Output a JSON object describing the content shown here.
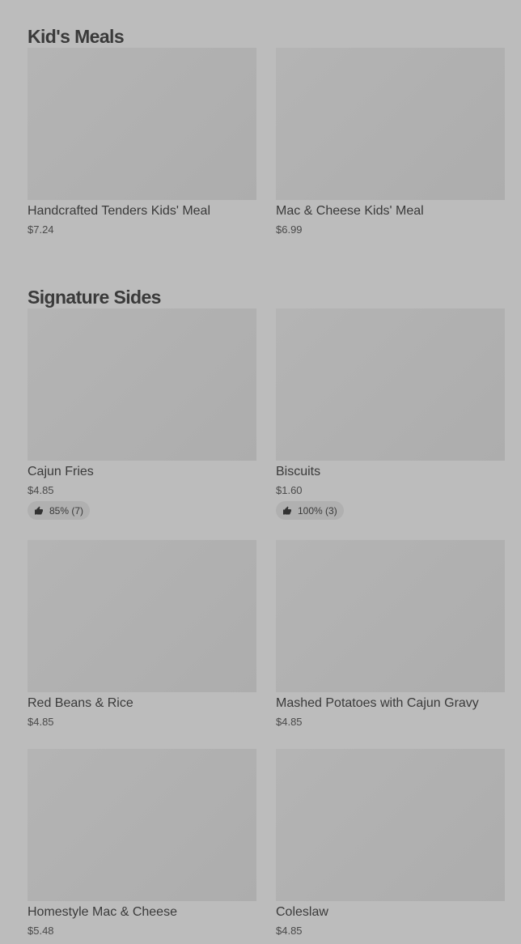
{
  "sections": [
    {
      "title": "Kid's Meals",
      "items": [
        {
          "name": "Handcrafted Tenders Kids' Meal",
          "price": "$7.24"
        },
        {
          "name": "Mac & Cheese Kids' Meal",
          "price": "$6.99"
        }
      ]
    },
    {
      "title": "Signature Sides",
      "items": [
        {
          "name": "Cajun Fries",
          "price": "$4.85",
          "rating": "85% (7)"
        },
        {
          "name": "Biscuits",
          "price": "$1.60",
          "rating": "100% (3)"
        },
        {
          "name": "Red Beans & Rice",
          "price": "$4.85"
        },
        {
          "name": "Mashed Potatoes with Cajun Gravy",
          "price": "$4.85"
        },
        {
          "name": "Homestyle Mac & Cheese",
          "price": "$5.48"
        },
        {
          "name": "Coleslaw",
          "price": "$4.85"
        }
      ]
    }
  ],
  "icons": {
    "rating": "thumbs-up-icon"
  }
}
